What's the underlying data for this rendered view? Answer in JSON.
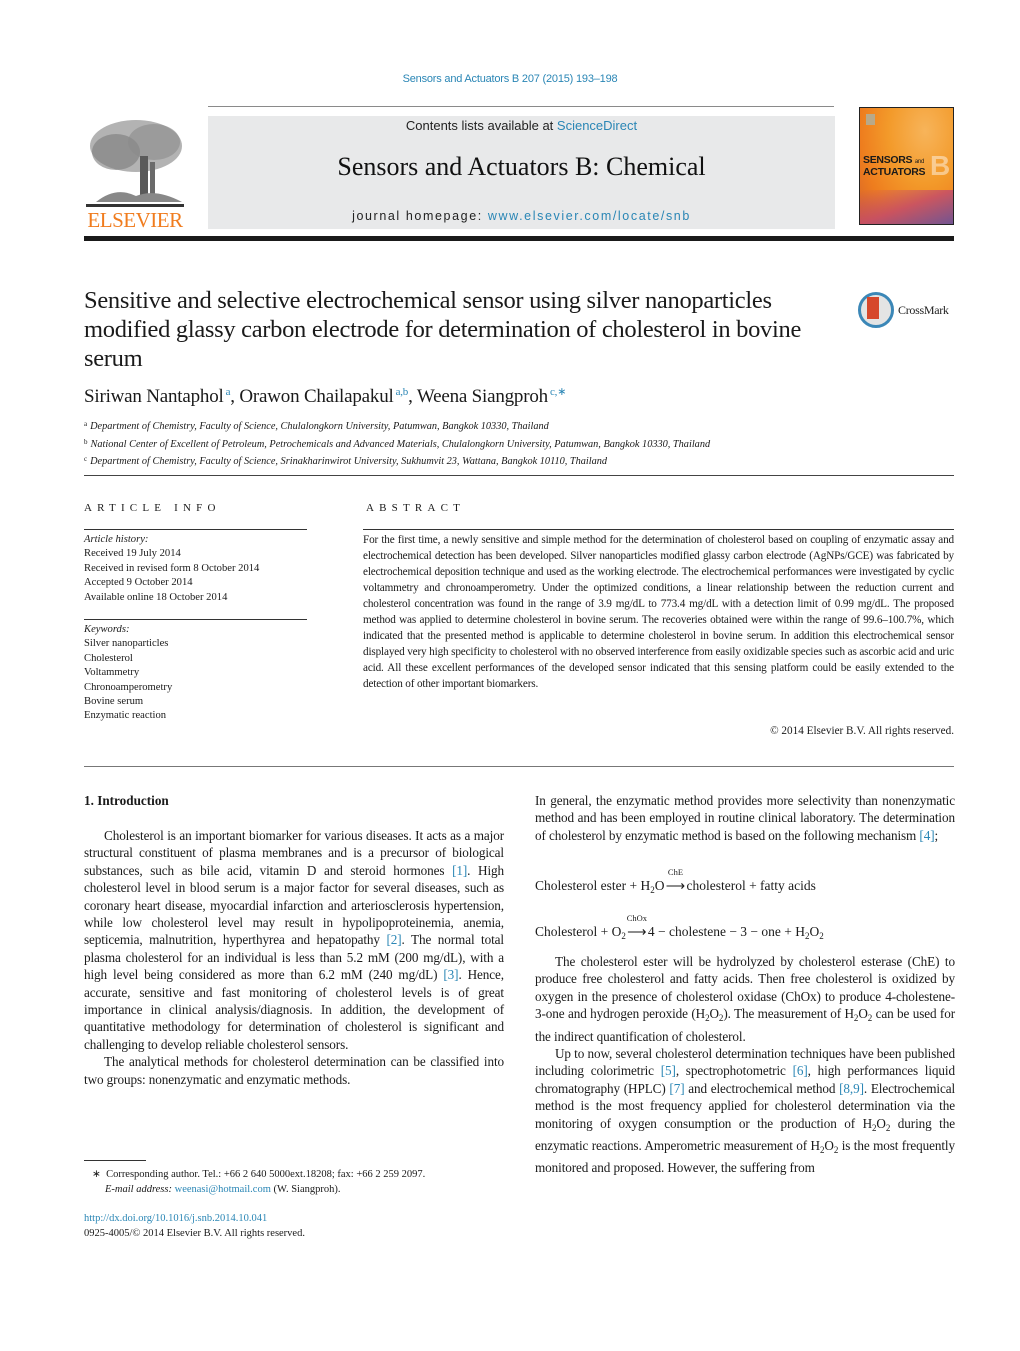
{
  "header": {
    "citation": "Sensors and Actuators B 207 (2015) 193–198",
    "publisher_logo_text": "ELSEVIER",
    "contents_prefix": "Contents lists available at ",
    "contents_link": "ScienceDirect",
    "journal_title": "Sensors and Actuators B: Chemical",
    "homepage_prefix": "journal homepage: ",
    "homepage_link": "www.elsevier.com/locate/snb",
    "cover": {
      "line1": "SENSORS",
      "and": "and",
      "line2": "ACTUATORS",
      "letter": "B"
    }
  },
  "article": {
    "title": "Sensitive and selective electrochemical sensor using silver nanoparticles modified glassy carbon electrode for determination of cholesterol in bovine serum",
    "crossmark_label": "CrossMark",
    "authors": [
      {
        "name": "Siriwan Nantaphol",
        "sup": "a",
        "sep": ", "
      },
      {
        "name": "Orawon Chailapakul",
        "sup": "a,b",
        "sep": ", "
      },
      {
        "name": "Weena Siangproh",
        "sup": "c,∗",
        "sep": ""
      }
    ],
    "affiliations": [
      {
        "mark": "a",
        "text": "Department of Chemistry, Faculty of Science, Chulalongkorn University, Patumwan, Bangkok 10330, Thailand"
      },
      {
        "mark": "b",
        "text": "National Center of Excellent of Petroleum, Petrochemicals and Advanced Materials, Chulalongkorn University, Patumwan, Bangkok 10330, Thailand"
      },
      {
        "mark": "c",
        "text": "Department of Chemistry, Faculty of Science, Srinakharinwirot University, Sukhumvit 23, Wattana, Bangkok 10110, Thailand"
      }
    ]
  },
  "article_info": {
    "label": "ARTICLE INFO",
    "history_head": "Article history:",
    "history": [
      "Received 19 July 2014",
      "Received in revised form 8 October 2014",
      "Accepted 9 October 2014",
      "Available online 18 October 2014"
    ],
    "keywords_head": "Keywords:",
    "keywords": [
      "Silver nanoparticles",
      "Cholesterol",
      "Voltammetry",
      "Chronoamperometry",
      "Bovine serum",
      "Enzymatic reaction"
    ]
  },
  "abstract": {
    "label": "ABSTRACT",
    "text": "For the first time, a newly sensitive and simple method for the determination of cholesterol based on coupling of enzymatic assay and electrochemical detection has been developed. Silver nanoparticles modified glassy carbon electrode (AgNPs/GCE) was fabricated by electrochemical deposition technique and used as the working electrode. The electrochemical performances were investigated by cyclic voltammetry and chronoamperometry. Under the optimized conditions, a linear relationship between the reduction current and cholesterol concentration was found in the range of 3.9 mg/dL to 773.4 mg/dL with a detection limit of 0.99 mg/dL. The proposed method was applied to determine cholesterol in bovine serum. The recoveries obtained were within the range of 99.6–100.7%, which indicated that the presented method is applicable to determine cholesterol in bovine serum. In addition this electrochemical sensor displayed very high specificity to cholesterol with no observed interference from easily oxidizable species such as ascorbic acid and uric acid. All these excellent performances of the developed sensor indicated that this sensing platform could be easily extended to the detection of other important biomarkers.",
    "copyright": "© 2014 Elsevier B.V. All rights reserved."
  },
  "body": {
    "section_heading": "1.  Introduction",
    "left": {
      "p1": {
        "t1": "Cholesterol is an important biomarker for various diseases. It acts as a major structural constituent of plasma membranes and is a precursor of biological substances, such as bile acid, vitamin D and steroid hormones ",
        "r1": "[1]",
        "t2": ". High cholesterol level in blood serum is a major factor for several diseases, such as coronary heart disease, myocardial infarction and arteriosclerosis hypertension, while low cholesterol level may result in hypolipoproteinemia, anemia, septicemia, malnutrition, hyperthyrea and hepatopathy ",
        "r2": "[2]",
        "t3": ". The normal total plasma cholesterol for an individual is less than 5.2 mM (200 mg/dL), with a high level being considered as more than 6.2 mM (240 mg/dL) ",
        "r3": "[3]",
        "t4": ". Hence, accurate, sensitive and fast monitoring of cholesterol levels is of great importance in clinical analysis/diagnosis. In addition, the development of quantitative methodology for determination of cholesterol is significant and challenging to develop reliable cholesterol sensors."
      },
      "p2": "The analytical methods for cholesterol determination can be classified into two groups: nonenzymatic and enzymatic methods."
    },
    "right": {
      "p1": {
        "t1": "In general, the enzymatic method provides more selectivity than nonenzymatic method and has been employed in routine clinical laboratory. The determination of cholesterol by enzymatic method is based on the following mechanism ",
        "r1": "[4]",
        "t2": ";"
      },
      "eq1": {
        "lhs": "Cholesterol ester + H",
        "lhs_sub": "2",
        "lhs_end": "O",
        "enzyme": "ChE",
        "rhs": "cholesterol + fatty acids"
      },
      "eq2": {
        "lhs": "Cholesterol + O",
        "lhs_sub": "2",
        "enzyme": "ChOx",
        "rhs": "4 − cholestene − 3 − one + H",
        "rhs_sub1": "2",
        "rhs_mid": "O",
        "rhs_sub2": "2"
      },
      "p2": {
        "t1": "The cholesterol ester will be hydrolyzed by cholesterol esterase (ChE) to produce free cholesterol and fatty acids. Then free cholesterol is oxidized by oxygen in the presence of cholesterol oxidase (ChOx) to produce 4-cholestene-3-one and hydrogen peroxide (H",
        "t2": "O",
        "t3": "). The measurement of H",
        "t4": "O",
        "t5": " can be used for the indirect quantification of cholesterol.",
        "sub": "2"
      },
      "p3": {
        "t1": "Up to now, several cholesterol determination techniques have been published including colorimetric ",
        "r5": "[5]",
        "t2": ", spectrophotometric ",
        "r6": "[6]",
        "t3": ", high performances liquid chromatography (HPLC) ",
        "r7": "[7]",
        "t4": " and electrochemical method ",
        "r89": "[8,9]",
        "t5": ". Electrochemical method is the most frequency applied for cholesterol determination via the monitoring of oxygen consumption or the production of H",
        "t6": "O",
        "t7": " during the enzymatic reactions. Amperometric measurement of H",
        "t8": "O",
        "t9": " is the most frequently monitored and proposed. However, the suffering from",
        "sub": "2"
      }
    }
  },
  "footnote": {
    "star": "∗",
    "line1": "Corresponding author. Tel.: +66 2 640 5000ext.18208; fax: +66 2 259 2097.",
    "email_label": "E-mail address:",
    "email": "weenasi@hotmail.com",
    "email_suffix": " (W. Siangproh)."
  },
  "doi": {
    "url": "http://dx.doi.org/10.1016/j.snb.2014.10.041",
    "issn_line": "0925-4005/© 2014 Elsevier B.V. All rights reserved."
  }
}
